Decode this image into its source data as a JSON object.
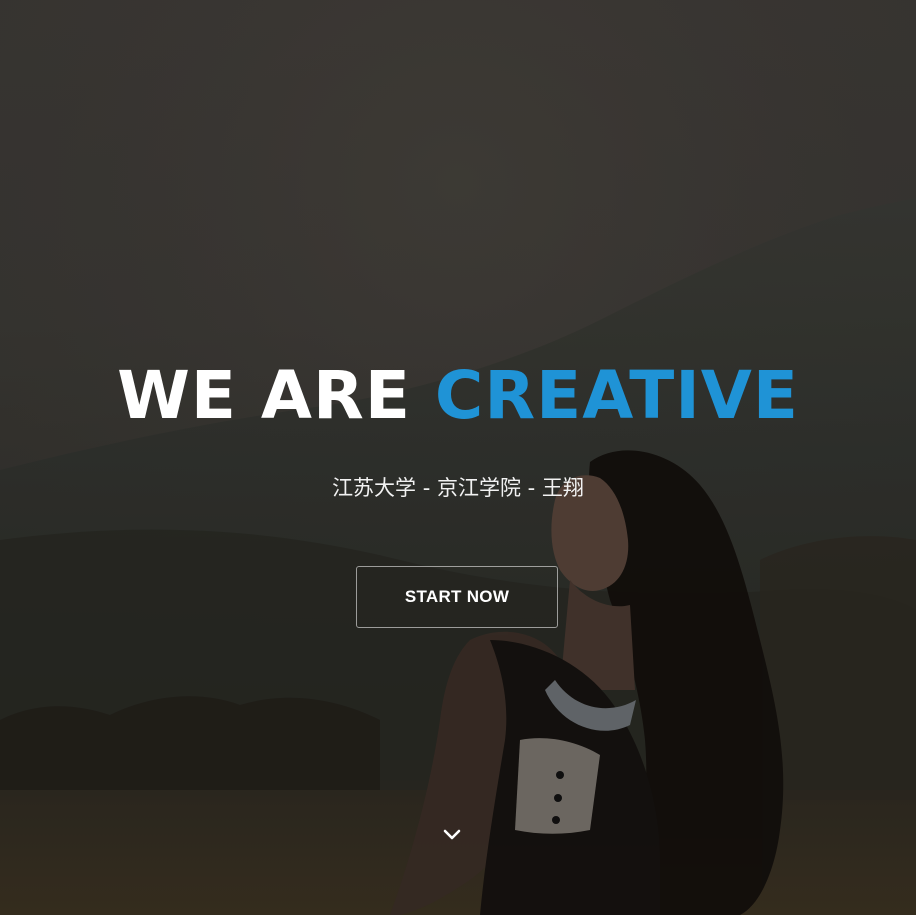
{
  "hero": {
    "title_part1": "WE ARE ",
    "title_part2": "CREATIVE",
    "subtitle": "江苏大学 - 京江学院 - 王翔",
    "cta_label": "START NOW",
    "scroll_icon": "chevron-down-icon"
  },
  "colors": {
    "accent": "#1f93d6",
    "text": "#ffffff"
  }
}
